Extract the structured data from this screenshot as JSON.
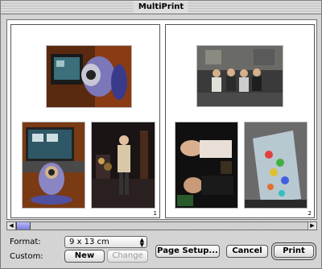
{
  "window": {
    "title": "MultiPrint"
  },
  "preview": {
    "pages": [
      {
        "number": "1"
      },
      {
        "number": "2"
      }
    ]
  },
  "format": {
    "label": "Format:",
    "selected": "9 x 13 cm"
  },
  "custom": {
    "label": "Custom:",
    "new_label": "New",
    "change_label": "Change"
  },
  "buttons": {
    "page_setup": "Page Setup...",
    "cancel": "Cancel",
    "print": "Print"
  },
  "icons": {
    "scroll_left": "left-arrow-icon",
    "scroll_right": "right-arrow-icon",
    "popup_arrows": "updown-arrow-icon"
  }
}
